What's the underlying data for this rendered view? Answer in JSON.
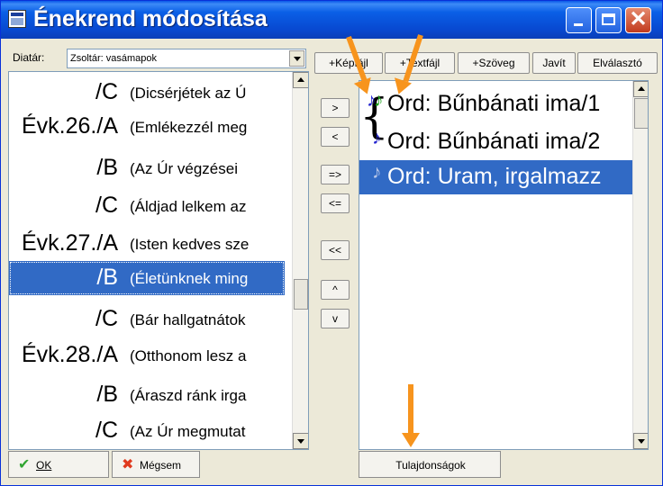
{
  "window": {
    "title": "Énekrend módosítása"
  },
  "diatar": {
    "label": "Diatár:",
    "value": "Zsoltár: vasámapok"
  },
  "left_rows": [
    {
      "code": "/C",
      "text": "(Dicsérjétek az Ú"
    },
    {
      "code": "Évk.26./A",
      "text": "(Emlékezzél meg"
    },
    {
      "code": "/B",
      "text": "(Az Úr végzései"
    },
    {
      "code": "/C",
      "text": "(Áldjad lelkem az"
    },
    {
      "code": "Évk.27./A",
      "text": "(Isten kedves sze"
    },
    {
      "code": "/B",
      "text": "(Életünknek ming"
    },
    {
      "code": "/C",
      "text": "(Bár hallgatnátok"
    },
    {
      "code": "Évk.28./A",
      "text": "(Otthonom lesz a"
    },
    {
      "code": "/B",
      "text": "(Áraszd ránk irga"
    },
    {
      "code": "/C",
      "text": "(Az Úr megmutat"
    }
  ],
  "mid_buttons": {
    "add": ">",
    "remove": "<",
    "add_all": "=>",
    "remove_all": "<=",
    "clear": "<<",
    "move_up": "^",
    "move_down": "v"
  },
  "toolbar": {
    "kepfajl": "+Képfájl",
    "textfajl": "+Textfájl",
    "szoveg": "+Szöveg",
    "javit": "Javít",
    "elvalaszto": "Elválasztó"
  },
  "right_items": [
    {
      "text": "Ord: Bűnbánati ima/1"
    },
    {
      "text": "Ord: Bűnbánati ima/2"
    },
    {
      "text": "Ord: Uram, irgalmazz"
    }
  ],
  "bottom": {
    "ok": "OK",
    "megsem": "Mégsem",
    "tulajdonsagok": "Tulajdonságok"
  },
  "colors": {
    "titlebar": "#0a5fe6",
    "selection": "#316ac5",
    "annotation_arrow": "#f7941d",
    "note_active": "#1fa31f",
    "note_blue": "#2a2ad0"
  },
  "icons": {
    "ok": "checkmark-icon",
    "cancel": "x-mark-icon",
    "note": "music-note-icon"
  }
}
